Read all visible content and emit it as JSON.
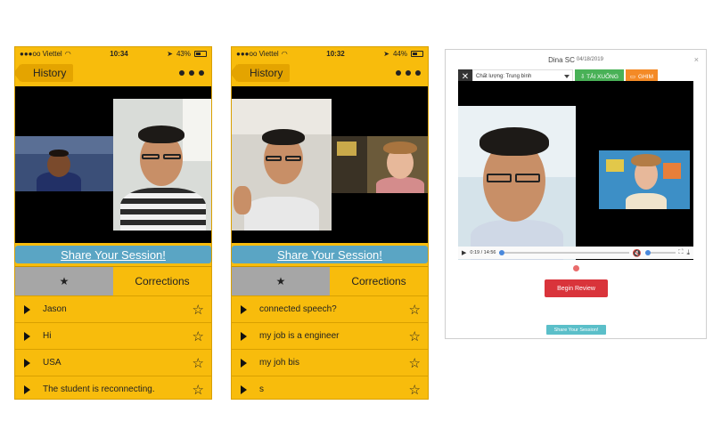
{
  "phone1": {
    "status": {
      "carrier": "●●●oo Viettel",
      "time": "10:34",
      "battery": "43%"
    },
    "back_label": "History",
    "share_label": "Share Your Session!",
    "tabs": {
      "star": "★",
      "corrections": "Corrections"
    },
    "items": [
      {
        "text": "Jason"
      },
      {
        "text": "Hi"
      },
      {
        "text": "USA"
      },
      {
        "text": "The student is reconnecting."
      }
    ]
  },
  "phone2": {
    "status": {
      "carrier": "●●●oo Viettel",
      "time": "10:32",
      "battery": "44%"
    },
    "back_label": "History",
    "share_label": "Share Your Session!",
    "tabs": {
      "star": "★",
      "corrections": "Corrections"
    },
    "items": [
      {
        "text": "connected speech?"
      },
      {
        "text": "my job is a engineer"
      },
      {
        "text": "my joh bis"
      },
      {
        "text": "s"
      }
    ]
  },
  "web": {
    "title": "Dina SC",
    "date": "04/18/2019",
    "close": "×",
    "quality": "Chất lượng: Trung bình",
    "download": "⇩ TẢI XUỐNG",
    "record": "GHIM",
    "time_readout": "0:19 / 14:56",
    "begin_review": "Begin Review",
    "share": "Share Your Session!"
  }
}
